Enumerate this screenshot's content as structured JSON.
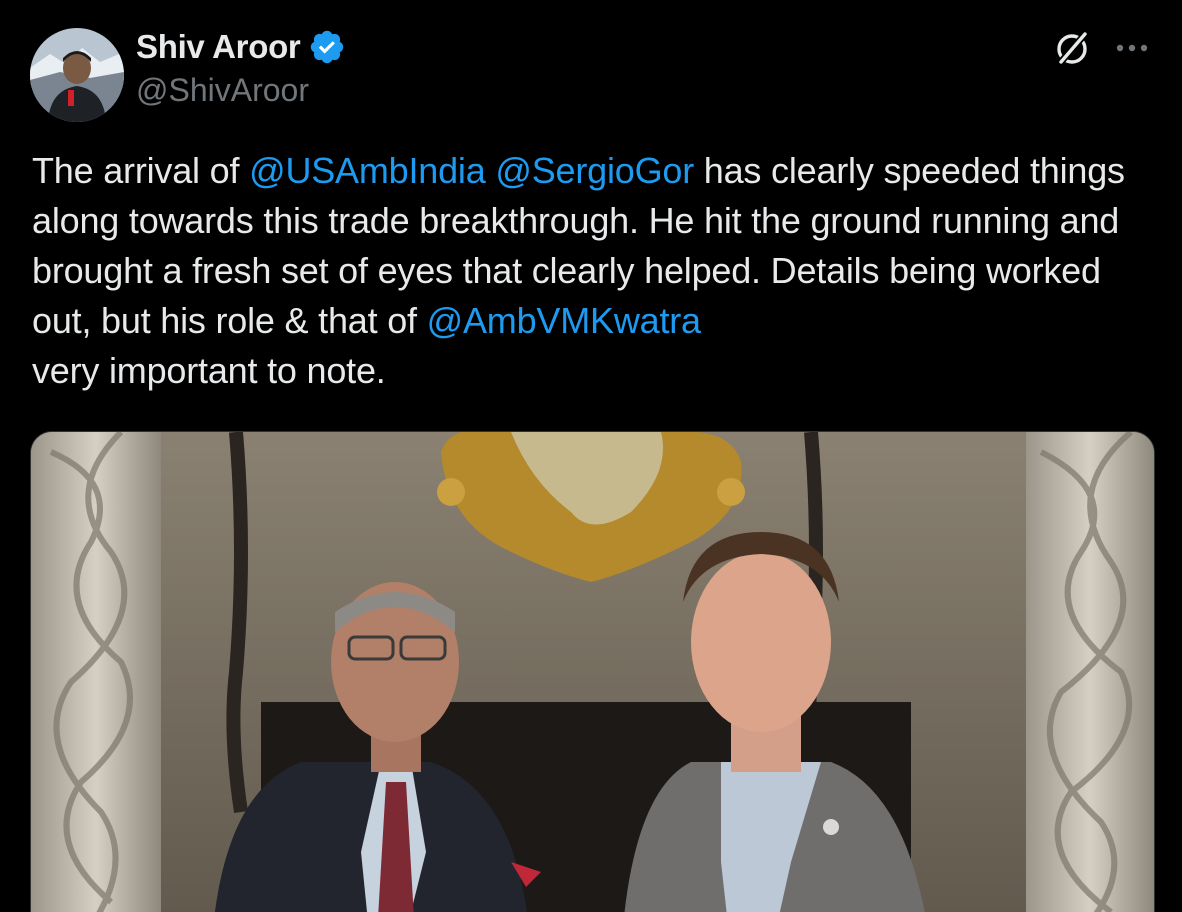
{
  "author": {
    "display_name": "Shiv Aroor",
    "handle": "@ShivAroor",
    "verified": true,
    "avatar_icon": "profile-photo"
  },
  "actions": {
    "grok_icon": "grok-slash-circle-icon",
    "more_icon": "more-horizontal-icon"
  },
  "tweet": {
    "segments": [
      {
        "text": "The arrival of ",
        "type": "text"
      },
      {
        "text": "@USAmbIndia",
        "type": "mention"
      },
      {
        "text": " ",
        "type": "text"
      },
      {
        "text": "@SergioGor",
        "type": "mention"
      },
      {
        "text": " has clearly speeded things along towards this trade breakthrough. He hit the ground running and brought a fresh set of eyes that clearly helped. Details being worked out, but his role & that of ",
        "type": "text"
      },
      {
        "text": "@AmbVMKwatra",
        "type": "mention"
      },
      {
        "text": " very important to note.",
        "type": "text"
      }
    ]
  },
  "media": {
    "type": "photo",
    "description_icon": "tweet-photo"
  },
  "colors": {
    "background": "#000000",
    "text": "#e7e9ea",
    "secondary": "#71767b",
    "link": "#1d9bf0",
    "verified": "#1d9bf0",
    "border": "#2f3336"
  }
}
